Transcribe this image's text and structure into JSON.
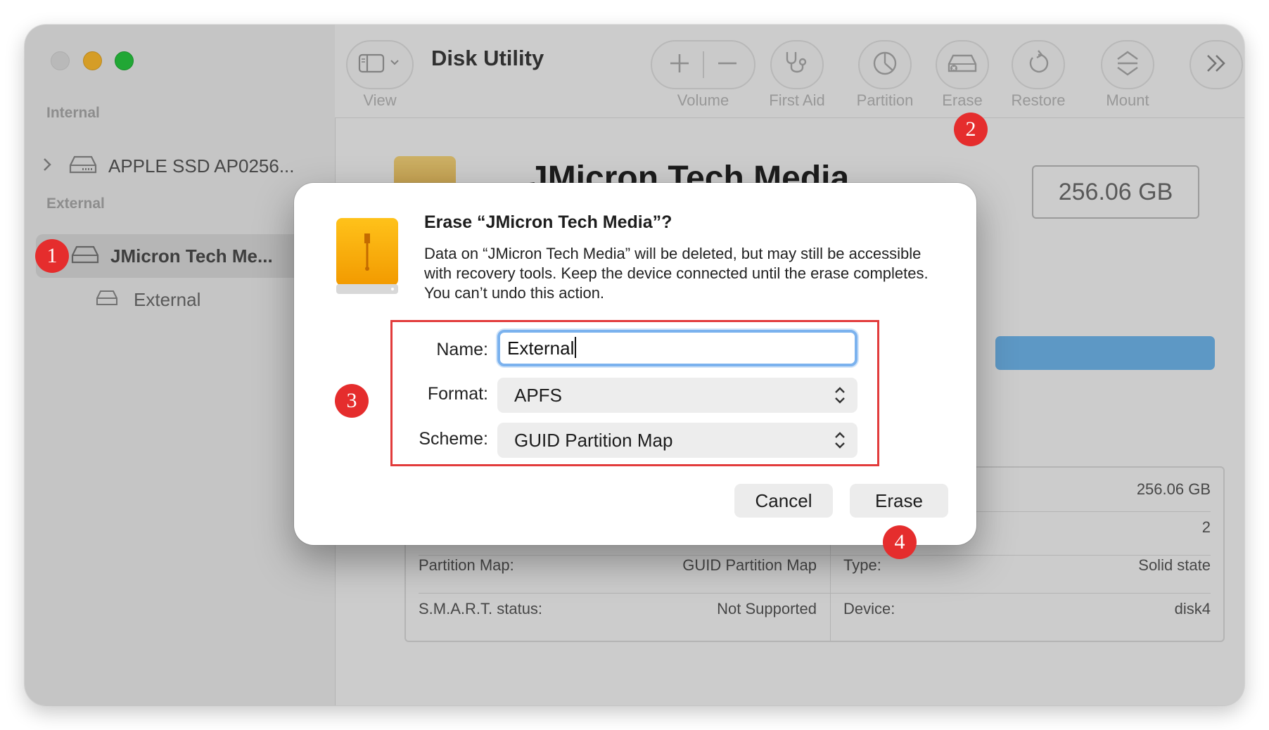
{
  "window": {
    "title": "Disk Utility"
  },
  "sidebar": {
    "internal_header": "Internal",
    "external_header": "External",
    "items": [
      {
        "label": "APPLE SSD AP0256...",
        "icon": "internal-drive-icon"
      },
      {
        "label": "JMicron Tech Me...",
        "icon": "external-drive-icon",
        "selected": true
      },
      {
        "label": "External",
        "icon": "volume-icon"
      }
    ]
  },
  "toolbar": {
    "view_label": "View",
    "volume_label": "Volume",
    "first_aid_label": "First Aid",
    "partition_label": "Partition",
    "erase_label": "Erase",
    "restore_label": "Restore",
    "mount_label": "Mount"
  },
  "main": {
    "device_name": "JMicron Tech Media",
    "capacity": "256.06 GB",
    "info": {
      "row1_right_value": "256.06 GB",
      "row2_right_value": "2",
      "partition_map_label": "Partition Map:",
      "partition_map_value": "GUID Partition Map",
      "type_label": "Type:",
      "type_value": "Solid state",
      "smart_label": "S.M.A.R.T. status:",
      "smart_value": "Not Supported",
      "device_label": "Device:",
      "device_value": "disk4"
    }
  },
  "dialog": {
    "title": "Erase “JMicron Tech Media”?",
    "message": "Data on “JMicron Tech Media” will be deleted, but may still be accessible with recovery tools. Keep the device connected until the erase completes. You can’t undo this action.",
    "name_label": "Name:",
    "name_value": "External",
    "format_label": "Format:",
    "format_value": "APFS",
    "scheme_label": "Scheme:",
    "scheme_value": "GUID Partition Map",
    "cancel_label": "Cancel",
    "erase_label": "Erase"
  },
  "annotations": {
    "badge1": "1",
    "badge2": "2",
    "badge3": "3",
    "badge4": "4"
  },
  "colors": {
    "annotation_red": "#e52d2d",
    "focus_blue": "#7bb2ee",
    "usage_blue": "#6fb5eb"
  }
}
